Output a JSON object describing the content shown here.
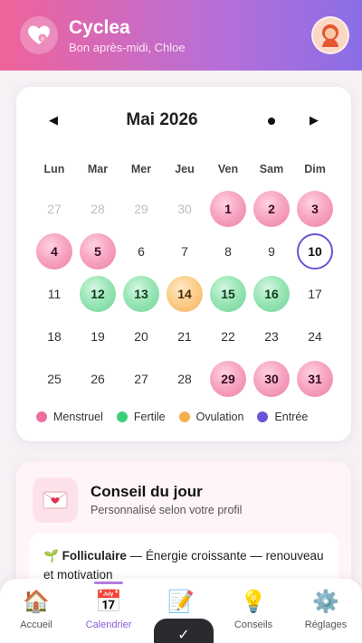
{
  "header": {
    "app_title": "Cyclea",
    "greeting": "Bon après-midi, Chloe",
    "logo_icon": "heart-logo-icon",
    "avatar_icon": "user-avatar-icon"
  },
  "calendar": {
    "month_title": "Mai 2026",
    "prev_label": "◀",
    "next_label": "▶",
    "weekdays": [
      "Lun",
      "Mar",
      "Mer",
      "Jeu",
      "Ven",
      "Sam",
      "Dim"
    ],
    "days": [
      {
        "n": "27",
        "type": "out"
      },
      {
        "n": "28",
        "type": "out"
      },
      {
        "n": "29",
        "type": "out"
      },
      {
        "n": "30",
        "type": "out"
      },
      {
        "n": "1",
        "type": "men"
      },
      {
        "n": "2",
        "type": "men"
      },
      {
        "n": "3",
        "type": "men"
      },
      {
        "n": "4",
        "type": "men"
      },
      {
        "n": "5",
        "type": "men"
      },
      {
        "n": "6",
        "type": ""
      },
      {
        "n": "7",
        "type": ""
      },
      {
        "n": "8",
        "type": ""
      },
      {
        "n": "9",
        "type": ""
      },
      {
        "n": "10",
        "type": "today"
      },
      {
        "n": "11",
        "type": ""
      },
      {
        "n": "12",
        "type": "fer"
      },
      {
        "n": "13",
        "type": "fer"
      },
      {
        "n": "14",
        "type": "ovu"
      },
      {
        "n": "15",
        "type": "fer"
      },
      {
        "n": "16",
        "type": "fer"
      },
      {
        "n": "17",
        "type": ""
      },
      {
        "n": "18",
        "type": ""
      },
      {
        "n": "19",
        "type": ""
      },
      {
        "n": "20",
        "type": ""
      },
      {
        "n": "21",
        "type": ""
      },
      {
        "n": "22",
        "type": ""
      },
      {
        "n": "23",
        "type": ""
      },
      {
        "n": "24",
        "type": ""
      },
      {
        "n": "25",
        "type": ""
      },
      {
        "n": "26",
        "type": ""
      },
      {
        "n": "27",
        "type": ""
      },
      {
        "n": "28",
        "type": ""
      },
      {
        "n": "29",
        "type": "men"
      },
      {
        "n": "30",
        "type": "men"
      },
      {
        "n": "31",
        "type": "men"
      }
    ],
    "legend": [
      {
        "label": "Menstruel",
        "color": "#ee6fa0"
      },
      {
        "label": "Fertile",
        "color": "#3ccf7c"
      },
      {
        "label": "Ovulation",
        "color": "#f6ad4c"
      },
      {
        "label": "Entrée",
        "color": "#6c52d6"
      }
    ]
  },
  "tip": {
    "icon": "love-letter-icon",
    "title": "Conseil du jour",
    "subtitle": "Personnalisé selon votre profil",
    "phase_emoji": "🌱",
    "phase": "Folliculaire",
    "text": " — Énergie croissante — renouveau et motivation"
  },
  "nav": {
    "items": [
      {
        "label": "Accueil",
        "icon": "house-icon",
        "emoji": "🏠"
      },
      {
        "label": "Calendrier",
        "icon": "calendar-icon",
        "emoji": "📅"
      },
      {
        "label": "",
        "icon": "memo-icon",
        "emoji": "📝"
      },
      {
        "label": "Conseils",
        "icon": "lightbulb-icon",
        "emoji": "💡"
      },
      {
        "label": "Réglages",
        "icon": "gear-icon",
        "emoji": "⚙️"
      }
    ],
    "active_index": 1,
    "fab_label": "✓"
  }
}
